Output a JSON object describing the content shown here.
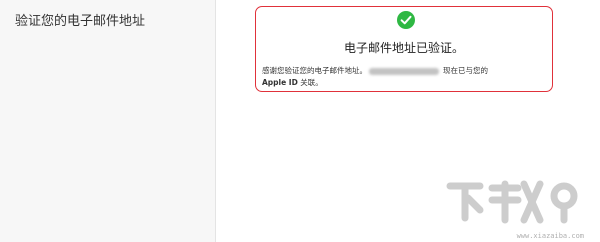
{
  "sidebar": {
    "title": "验证您的电子邮件地址"
  },
  "notice": {
    "icon": "green-checkmark-icon",
    "accent_color": "#e0313a",
    "check_color": "#2fb843",
    "heading": "电子邮件地址已验证。",
    "body_prefix": "感谢您验证您的电子邮件地址。",
    "body_suffix": "现在已与您的",
    "apple_id": "Apple ID",
    "body_end": "关联。"
  },
  "watermark": {
    "text": "www.xiazaiba.com"
  }
}
